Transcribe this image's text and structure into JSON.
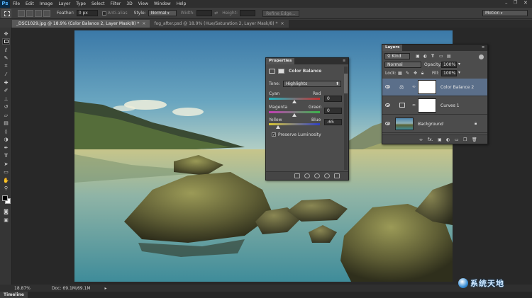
{
  "app": {
    "logo": "Ps"
  },
  "menu": [
    "File",
    "Edit",
    "Image",
    "Layer",
    "Type",
    "Select",
    "Filter",
    "3D",
    "View",
    "Window",
    "Help"
  ],
  "options": {
    "feather_label": "Feather:",
    "feather_value": "0 px",
    "antialias_label": "Anti-alias",
    "style_label": "Style:",
    "style_value": "Normal",
    "width_label": "Width:",
    "height_label": "Height:",
    "refine_edge": "Refine Edge...",
    "workspace": "Motion"
  },
  "tabs": [
    {
      "label": "_DSC1029.jpg @ 18.9% (Color Balance 2, Layer Mask/8) *",
      "close": "×"
    },
    {
      "label": "fog_after.psd @ 18.9% (Hue/Saturation 2, Layer Mask/8) *",
      "close": "×"
    }
  ],
  "properties": {
    "panel_title": "Properties",
    "adjustment_title": "Color Balance",
    "tone_label": "Tone:",
    "tone_value": "Highlights",
    "sliders": [
      {
        "left": "Cyan",
        "right": "Red",
        "value": "0",
        "level": 0.5,
        "gradient": [
          "#1fb8c4",
          "#c43030"
        ]
      },
      {
        "left": "Magenta",
        "right": "Green",
        "value": "0",
        "level": 0.5,
        "gradient": [
          "#c43cb4",
          "#3ab54a"
        ]
      },
      {
        "left": "Yellow",
        "right": "Blue",
        "value": "-65",
        "level": 0.18,
        "gradient": [
          "#d9c634",
          "#2f3fc4"
        ]
      }
    ],
    "preserve_label": "Preserve Luminosity"
  },
  "layers": {
    "panel_title": "Layers",
    "kind_label": "Kind",
    "blend_mode": "Normal",
    "opacity_label": "Opacity:",
    "opacity_value": "100%",
    "lock_label": "Lock:",
    "fill_label": "Fill:",
    "fill_value": "100%",
    "items": [
      {
        "name": "Color Balance 2",
        "selected": true,
        "kind": "color-balance-icon"
      },
      {
        "name": "Curves 1",
        "selected": false,
        "kind": "curves-icon"
      },
      {
        "name": "Background",
        "selected": false,
        "kind": "photo-thumbnail"
      }
    ],
    "footer_fx": "fx."
  },
  "status": {
    "zoom": "18.87%",
    "doc_info": "Doc: 69.1M/69.1M"
  },
  "timeline": {
    "label": "Timeline"
  },
  "watermark": {
    "text": "系统天地"
  },
  "colors": {
    "accent_selected_layer": "#5b6f8a",
    "panel_bg": "#4c4c4c",
    "app_bg": "#3a3a3a"
  }
}
